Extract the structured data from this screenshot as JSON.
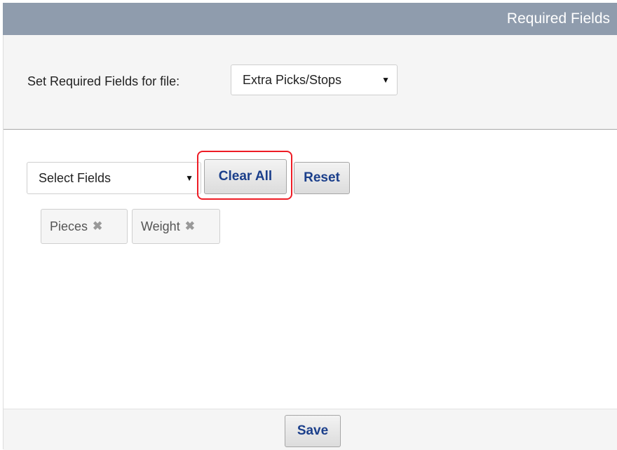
{
  "header": {
    "title": "Required Fields"
  },
  "file_section": {
    "label": "Set Required Fields for file:",
    "selected_file": "Extra Picks/Stops"
  },
  "fields_section": {
    "select_placeholder": "Select Fields",
    "clear_all_label": "Clear All",
    "reset_label": "Reset",
    "tags": [
      {
        "label": "Pieces"
      },
      {
        "label": "Weight"
      }
    ]
  },
  "footer": {
    "save_label": "Save"
  },
  "colors": {
    "header_bg": "#8f9cad",
    "button_text": "#1b3f8b",
    "highlight": "#ee1c25"
  },
  "icons": {
    "dropdown": "caret-down-icon",
    "remove_tag": "remove-x-icon"
  }
}
